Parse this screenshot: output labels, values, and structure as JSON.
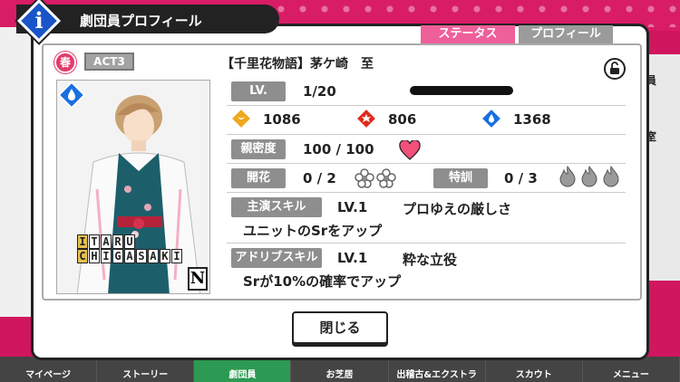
{
  "modal": {
    "title": "劇団員プロフィール",
    "info_letter": "i",
    "tabs": [
      {
        "label": "ステータス",
        "active": true
      },
      {
        "label": "プロフィール",
        "active": false
      }
    ],
    "close_label": "閉じる"
  },
  "card": {
    "season_badge": "春",
    "act_badge": "ACT3",
    "name_row1": [
      "I",
      "T",
      "A",
      "R",
      "U"
    ],
    "name_row2": [
      "C",
      "H",
      "I",
      "G",
      "A",
      "S",
      "A",
      "K",
      "I"
    ],
    "rarity": "N"
  },
  "character": {
    "full_name": "【千里花物語】茅ケ崎　至"
  },
  "status": {
    "lv_label": "LV.",
    "lv_value": "1/20",
    "stats": [
      {
        "icon": "comedy-mask-icon",
        "value": "1086",
        "color": "#f0a81e"
      },
      {
        "icon": "action-burst-icon",
        "value": "806",
        "color": "#e02a1c"
      },
      {
        "icon": "water-drop-icon",
        "value": "1368",
        "color": "#1a6fe0"
      }
    ],
    "intimacy_label": "親密度",
    "intimacy_value": "100 / 100",
    "bloom_label": "開花",
    "bloom_value": "0 / 2",
    "training_label": "特訓",
    "training_value": "0 / 3",
    "lead_skill_label": "主演スキル",
    "lead_skill_level": "LV.1",
    "lead_skill_name": "プロゆえの厳しさ",
    "lead_skill_desc": "ユニットのSrをアップ",
    "adlib_skill_label": "アドリブスキル",
    "adlib_skill_level": "LV.1",
    "adlib_skill_name": "粋な立役",
    "adlib_skill_desc": "Srが10%の確率でアップ"
  },
  "background": {
    "right_labels": [
      "員",
      "室"
    ]
  },
  "bottom_nav": [
    {
      "label": "マイページ",
      "active": false
    },
    {
      "label": "ストーリー",
      "active": false
    },
    {
      "label": "劇団員",
      "active": true
    },
    {
      "label": "お芝居",
      "active": false
    },
    {
      "label": "出稽古&エクストラ",
      "active": false
    },
    {
      "label": "スカウト",
      "active": false
    },
    {
      "label": "メニュー",
      "active": false
    }
  ],
  "colors": {
    "accent_pink": "#ef5f9a",
    "background": "#d0165e",
    "info_blue": "#1a55c8"
  }
}
